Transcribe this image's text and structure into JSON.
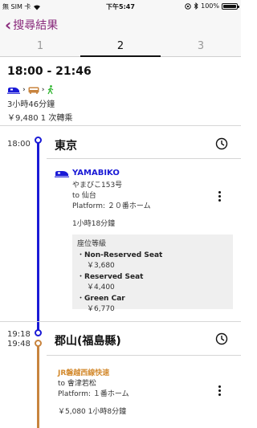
{
  "status_bar": {
    "carrier": "無 SIM 卡",
    "time": "下午5:47",
    "battery": "100%",
    "battery_level": 1.0
  },
  "nav": {
    "back_label": "搜尋結果"
  },
  "tabs": [
    {
      "label": "1",
      "active": false
    },
    {
      "label": "2",
      "active": true
    },
    {
      "label": "3",
      "active": false
    }
  ],
  "summary": {
    "time_range": "18:00 - 21:46",
    "modes": [
      "train-icon",
      "bus-icon",
      "walk-icon"
    ],
    "duration": "3小時46分鐘",
    "fare_transfers": "￥9,480  1 次轉乘"
  },
  "stops": [
    {
      "time": "18:00",
      "name": "東京",
      "train": {
        "name": "YAMABIKO",
        "number": "やまびこ153号",
        "direction": "to 仙台",
        "platform": "Platform: ２０番ホーム",
        "duration": "1小時18分鐘"
      },
      "seats": {
        "title": "座位等級",
        "items": [
          {
            "name": "Non-Reserved Seat",
            "price": "￥3,680"
          },
          {
            "name": "Reserved Seat",
            "price": "￥4,400"
          },
          {
            "name": "Green Car",
            "price": "￥6,770"
          }
        ]
      }
    },
    {
      "arrive_time": "19:18",
      "depart_time": "19:48",
      "name": "郡山(福島縣)",
      "train": {
        "name": "JR磐越西線快速",
        "direction": "to 會津若松",
        "platform": "Platform: １番ホーム",
        "fare_duration": "￥5,080  1小時8分鐘"
      }
    }
  ],
  "colors": {
    "accent": "#8a2b7c",
    "line_blue": "#1a1ad6",
    "line_orange": "#c8843e",
    "walk_green": "#2db52d"
  }
}
